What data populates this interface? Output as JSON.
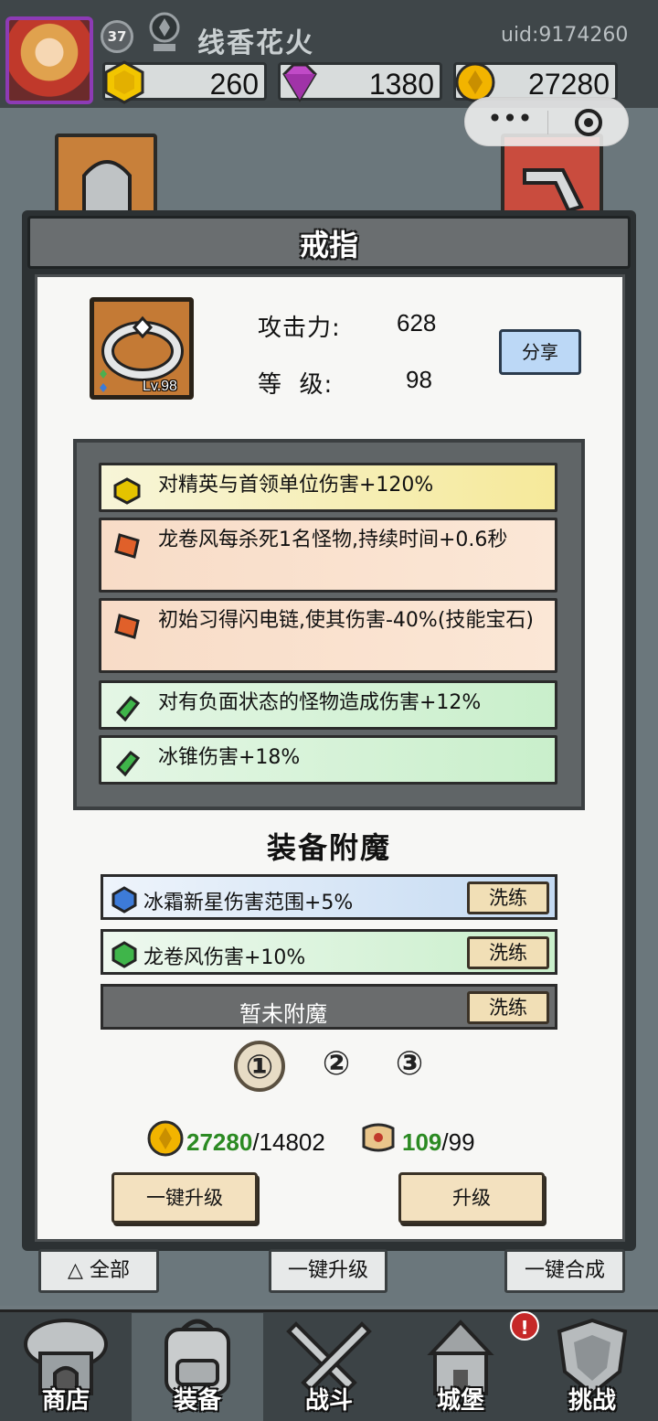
{
  "player": {
    "level": "37",
    "name": "线香花火",
    "uid": "uid:9174260"
  },
  "resources": {
    "gold_bar": "260",
    "diamond": "1380",
    "coin": "27280"
  },
  "modal": {
    "title": "戒指",
    "item_level": "Lv.98",
    "attack_label": "攻击力:",
    "attack_value": "628",
    "level_label": "等  级:",
    "level_value": "98",
    "share_label": "分享",
    "affixes": [
      {
        "text": "对精英与首领单位伤害+120%",
        "rarity": "yellow"
      },
      {
        "text": "龙卷风每杀死1名怪物,持续时间+0.6秒",
        "rarity": "orange"
      },
      {
        "text": "初始习得闪电链,使其伤害-40%(技能宝石)",
        "rarity": "orange"
      },
      {
        "text": "对有负面状态的怪物造成伤害+12%",
        "rarity": "green"
      },
      {
        "text": "冰锥伤害+18%",
        "rarity": "green"
      }
    ],
    "enchant_title": "装备附魔",
    "enchants": [
      {
        "text": "冰霜新星伤害范围+5%",
        "button": "洗练",
        "gem": "blue"
      },
      {
        "text": "龙卷风伤害+10%",
        "button": "洗练",
        "gem": "green"
      },
      {
        "text": "暂未附魔",
        "button": "洗练",
        "gem": "none"
      }
    ],
    "pages": [
      "①",
      "②",
      "③"
    ],
    "coin_cost": {
      "have": "27280",
      "need": "/14802"
    },
    "scroll_cost": {
      "have": "109",
      "need": "/99"
    },
    "one_click_upgrade": "一键升级",
    "upgrade": "升级"
  },
  "below": {
    "filter": "全部",
    "one_click_upgrade": "一键升级",
    "one_click_merge": "一键合成"
  },
  "nav": {
    "shop": "商店",
    "equip": "装备",
    "battle": "战斗",
    "castle": "城堡",
    "challenge": "挑战",
    "alert": "!"
  },
  "colors": {
    "yellow": "#f6e99a",
    "orange": "#f7c9a6",
    "green": "#c9efcb",
    "blue": "#c4daf2",
    "accent_green": "#2b8a22"
  }
}
